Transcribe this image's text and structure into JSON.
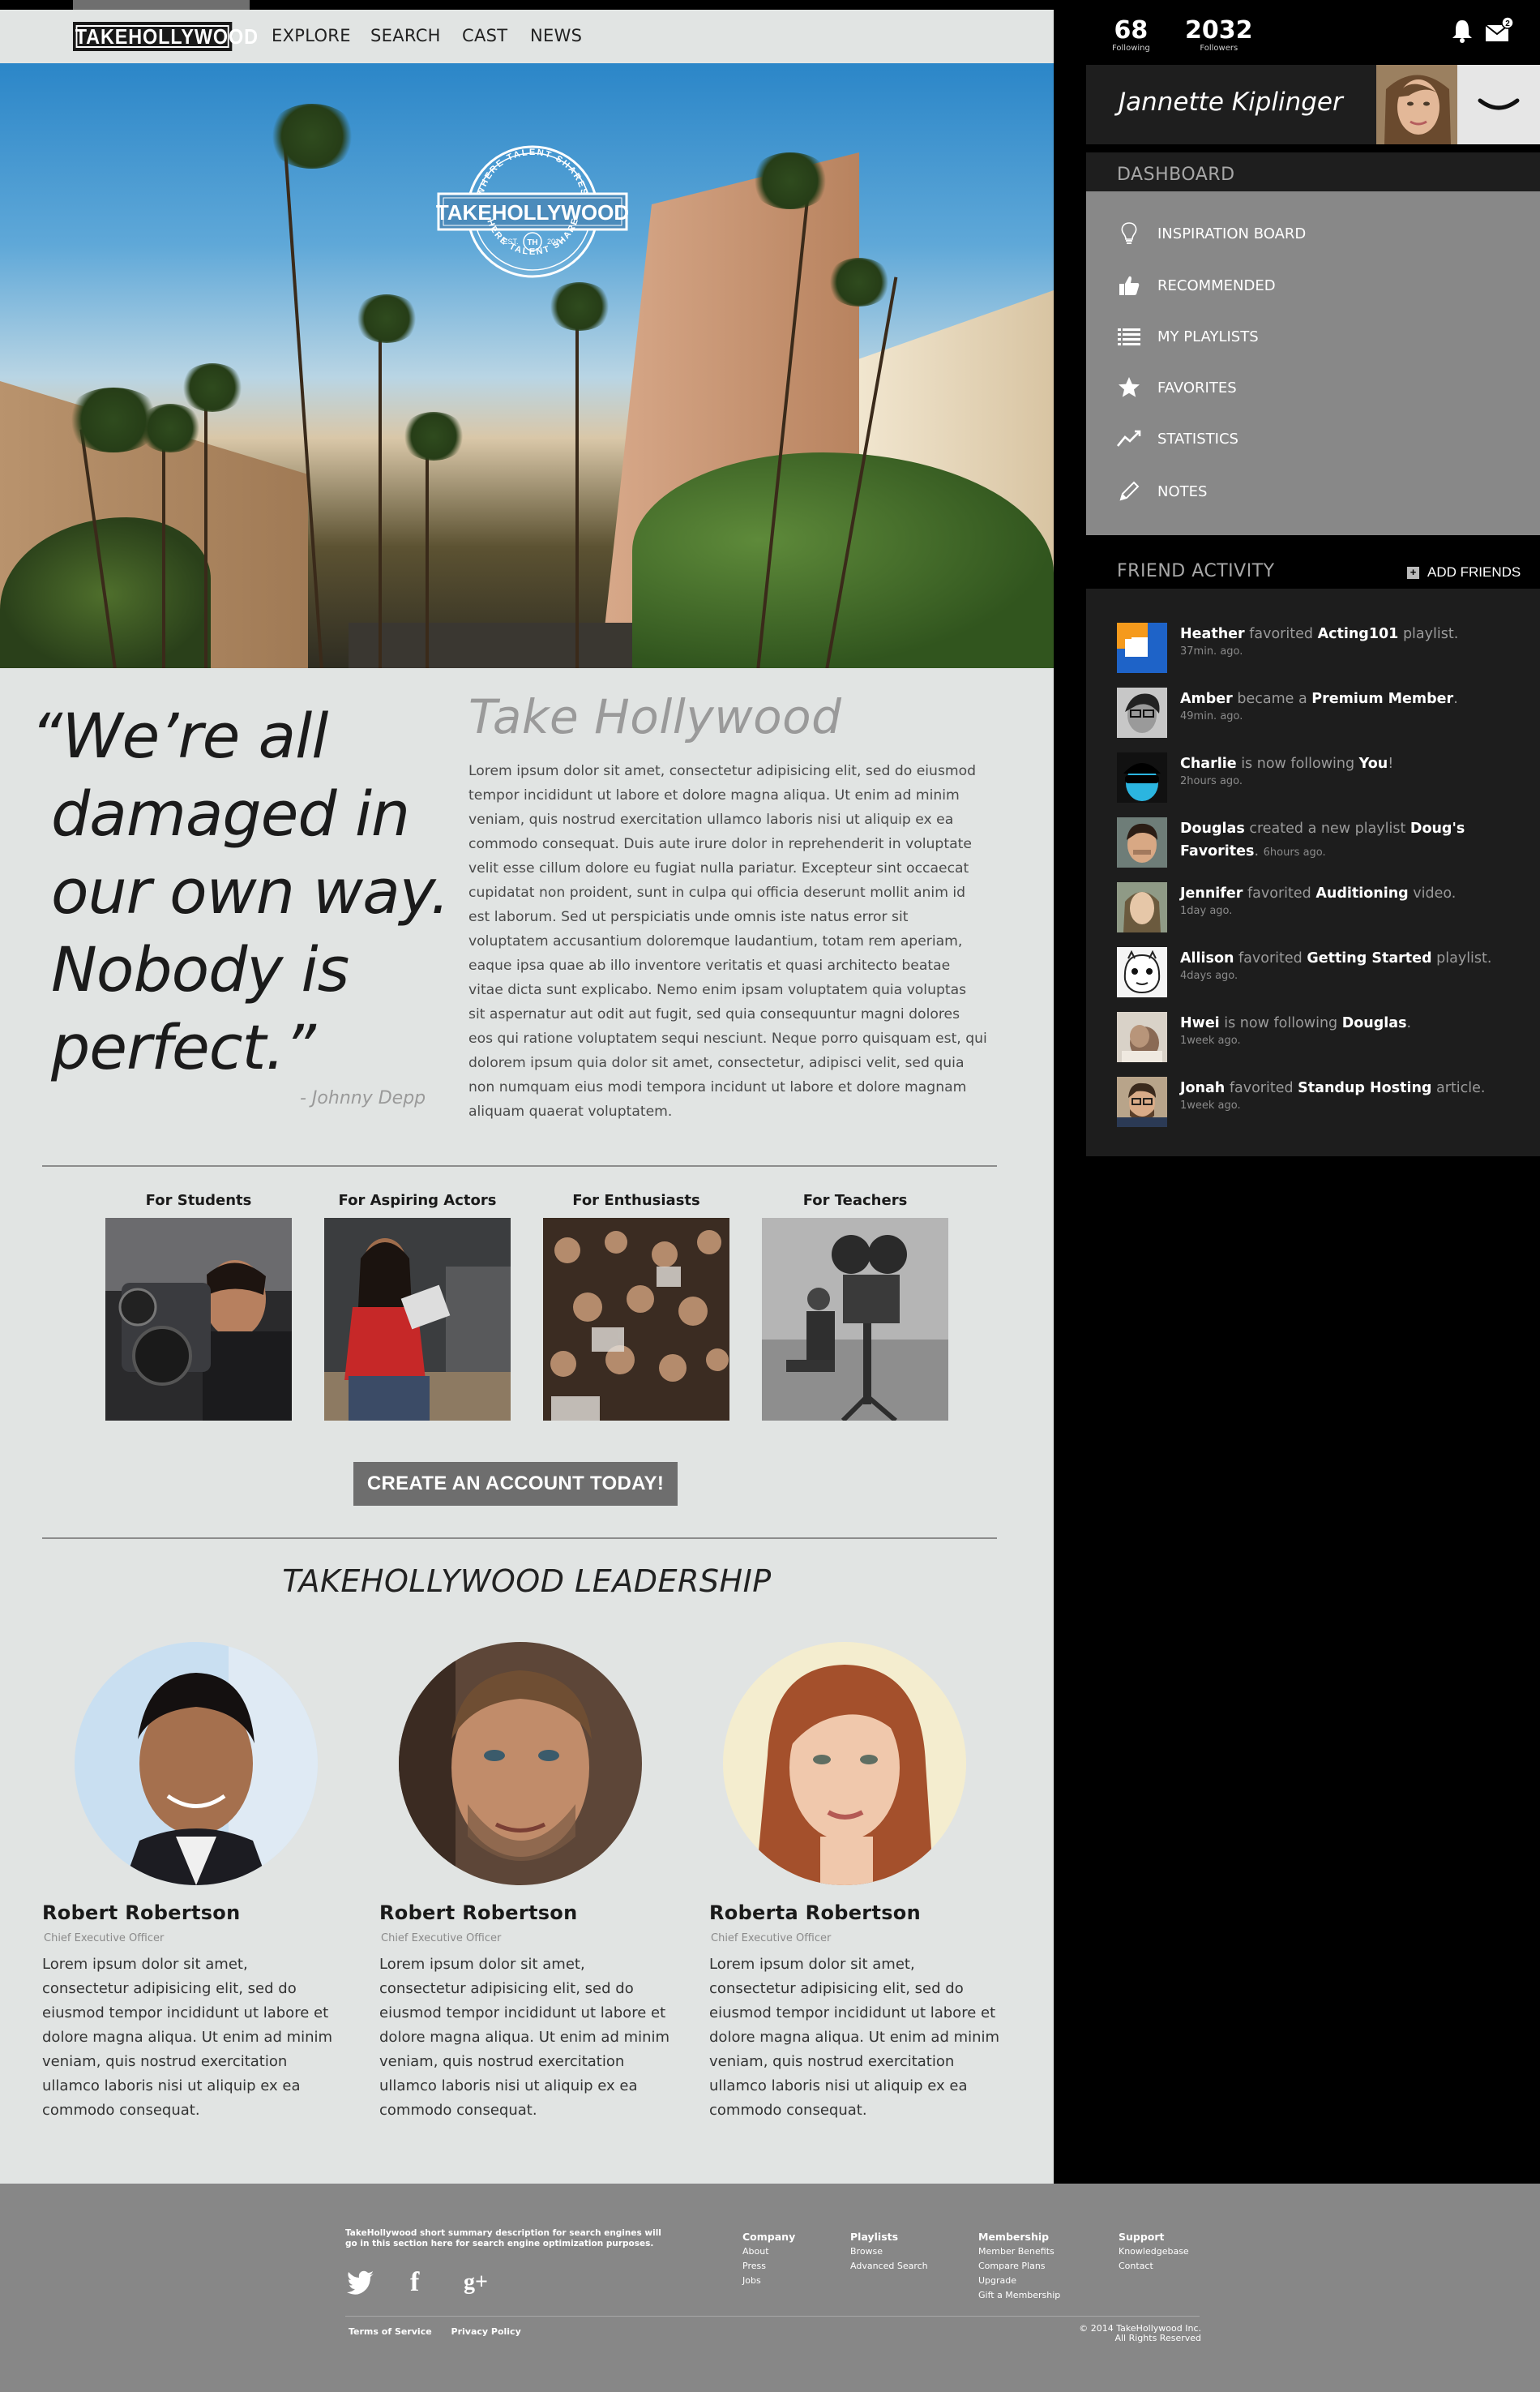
{
  "nav": {
    "logo": "TAKEHOLLYWOOD",
    "links": [
      "EXPLORE",
      "SEARCH",
      "CAST",
      "NEWS"
    ]
  },
  "hero": {
    "seal_top": "WHERE TALENT SHARES",
    "seal_name": "TAKEHOLLYWOOD",
    "seal_est": "EST.",
    "seal_year": "2014",
    "seal_mark": "TH",
    "seal_bottom": "WHERE TALENT SHARES"
  },
  "quote": {
    "lines": [
      "“We’re all",
      "damaged in",
      "our own way.",
      "Nobody is",
      "perfect.”"
    ],
    "author": "- Johnny Depp"
  },
  "about": {
    "title": "Take Hollywood",
    "body": "Lorem ipsum dolor sit amet, consectetur adipisicing elit, sed do eiusmod tempor incididunt ut labore et dolore magna aliqua. Ut enim ad minim veniam, quis nostrud exercitation ullamco laboris nisi ut aliquip ex ea commodo consequat. Duis aute irure dolor in reprehenderit in voluptate velit esse cillum dolore eu fugiat nulla pariatur. Excepteur sint occaecat cupidatat non proident, sunt in culpa qui officia deserunt mollit anim id est laborum. Sed ut perspiciatis unde omnis iste natus error sit voluptatem accusantium doloremque laudantium, totam rem aperiam, eaque ipsa quae ab illo inventore veritatis et quasi architecto beatae vitae dicta sunt explicabo. Nemo enim ipsam voluptatem quia voluptas sit aspernatur aut odit aut fugit, sed quia consequuntur magni dolores eos qui ratione voluptatem sequi nesciunt. Neque porro quisquam est, qui dolorem ipsum quia dolor sit amet, consectetur, adipisci velit, sed quia non numquam eius modi tempora incidunt ut labore et dolore magnam aliquam quaerat voluptatem."
  },
  "audiences": [
    {
      "title": "For Students"
    },
    {
      "title": "For Aspiring Actors"
    },
    {
      "title": "For Enthusiasts"
    },
    {
      "title": "For Teachers"
    }
  ],
  "cta": {
    "label": "CREATE AN ACCOUNT TODAY!"
  },
  "leadership": {
    "title": "TAKEHOLLYWOOD LEADERSHIP",
    "people": [
      {
        "name": "Robert Robertson",
        "role": "Chief Executive Officer",
        "bio": "Lorem ipsum dolor sit amet, consectetur adipisicing elit, sed do eiusmod tempor incididunt ut labore et dolore magna aliqua. Ut enim ad minim veniam, quis nostrud exercitation ullamco laboris nisi ut aliquip ex ea commodo consequat."
      },
      {
        "name": "Robert Robertson",
        "role": "Chief Executive Officer",
        "bio": "Lorem ipsum dolor sit amet, consectetur adipisicing elit, sed do eiusmod tempor incididunt ut labore et dolore magna aliqua. Ut enim ad minim veniam, quis nostrud exercitation ullamco laboris nisi ut aliquip ex ea commodo consequat."
      },
      {
        "name": "Roberta Robertson",
        "role": "Chief Executive Officer",
        "bio": "Lorem ipsum dolor sit amet, consectetur adipisicing elit, sed do eiusmod tempor incididunt ut labore et dolore magna aliqua. Ut enim ad minim veniam, quis nostrud exercitation ullamco laboris nisi ut aliquip ex ea commodo consequat."
      }
    ]
  },
  "sidebar": {
    "following_count": "68",
    "following_label": "Following",
    "followers_count": "2032",
    "followers_label": "Followers",
    "mail_badge": "2",
    "username": "Jannette Kiplinger",
    "dashboard_title": "DASHBOARD",
    "dashboard_items": [
      {
        "label": "INSPIRATION BOARD",
        "icon": "lightbulb-icon"
      },
      {
        "label": "RECOMMENDED",
        "icon": "thumbs-up-icon"
      },
      {
        "label": "MY PLAYLISTS",
        "icon": "list-icon"
      },
      {
        "label": "FAVORITES",
        "icon": "star-icon"
      },
      {
        "label": "STATISTICS",
        "icon": "chart-line-icon"
      },
      {
        "label": "NOTES",
        "icon": "pencil-icon"
      }
    ],
    "friend_activity_title": "FRIEND ACTIVITY",
    "add_friends_label": "ADD FRIENDS",
    "activity": [
      {
        "name": "Heather",
        "verb": "favorited",
        "object": "Acting101",
        "suffix": "playlist.",
        "time": "37min. ago."
      },
      {
        "name": "Amber",
        "verb": "became a",
        "object": "Premium Member",
        "suffix": ".",
        "time": "49min. ago."
      },
      {
        "name": "Charlie",
        "verb": "is now following",
        "object": "You",
        "suffix": "!",
        "time": "2hours ago."
      },
      {
        "name": "Douglas",
        "verb": "created a new playlist",
        "object": "Doug's Favorites",
        "suffix": ".",
        "time": "6hours ago."
      },
      {
        "name": "Jennifer",
        "verb": "favorited",
        "object": "Auditioning",
        "suffix": "video.",
        "time": "1day ago."
      },
      {
        "name": "Allison",
        "verb": "favorited",
        "object": "Getting Started",
        "suffix": "playlist.",
        "time": "4days ago."
      },
      {
        "name": "Hwei",
        "verb": "is now following",
        "object": "Douglas",
        "suffix": ".",
        "time": "1week ago."
      },
      {
        "name": "Jonah",
        "verb": "favorited",
        "object": "Standup Hosting",
        "suffix": "article.",
        "time": "1week ago."
      }
    ]
  },
  "footer": {
    "description": "TakeHollywood short summary description for  search engines will go in this section here for search engine optimization purposes.",
    "social": [
      "twitter-icon",
      "facebook-icon",
      "google-plus-icon"
    ],
    "social_glyphs": [
      "🐦",
      "f",
      "g+"
    ],
    "columns": [
      {
        "heading": "Company",
        "links": [
          "About",
          "Press",
          "Jobs"
        ]
      },
      {
        "heading": "Playlists",
        "links": [
          "Browse",
          "Advanced Search"
        ]
      },
      {
        "heading": "Membership",
        "links": [
          "Member Benefits",
          "Compare Plans",
          "Upgrade",
          "Gift a Membership"
        ]
      },
      {
        "heading": "Support",
        "links": [
          "Knowledgebase",
          "Contact"
        ]
      }
    ],
    "terms": "Terms of Service",
    "privacy": "Privacy Policy",
    "copyright_1": "© 2014 TakeHollywood Inc.",
    "copyright_2": "All Rights Reserved"
  }
}
